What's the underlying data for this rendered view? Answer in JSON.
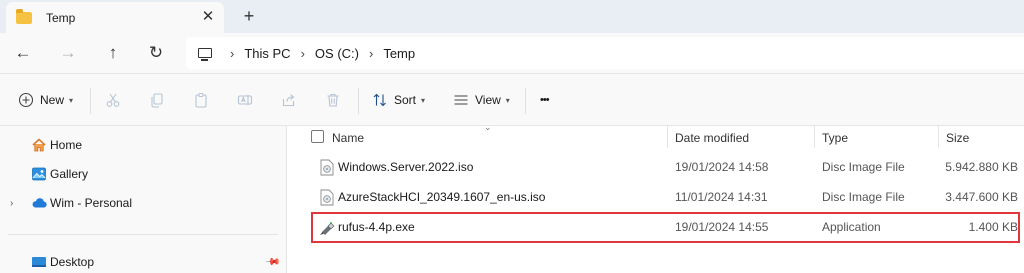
{
  "window": {
    "tab_title": "Temp",
    "tab_close": "✕",
    "new_tab": "+"
  },
  "nav": {
    "back": "←",
    "forward": "→",
    "up": "↑",
    "refresh": "↻",
    "breadcrumbs": [
      "This PC",
      "OS (C:)",
      "Temp"
    ],
    "separator": "›"
  },
  "toolbar": {
    "new_label": "New",
    "sort_label": "Sort",
    "view_label": "View",
    "more_label": "•••",
    "icons": [
      "cut-icon",
      "copy-icon",
      "paste-icon",
      "rename-icon",
      "share-icon",
      "delete-icon"
    ]
  },
  "sidebar": {
    "items": [
      {
        "label": "Home",
        "icon": "home-icon"
      },
      {
        "label": "Gallery",
        "icon": "gallery-icon"
      },
      {
        "label": "Wim - Personal",
        "icon": "onedrive-cloud-icon"
      },
      {
        "label": "Desktop",
        "icon": "desktop-icon"
      }
    ]
  },
  "columns": {
    "name": "Name",
    "date_modified": "Date modified",
    "type": "Type",
    "size": "Size"
  },
  "files": [
    {
      "name": "Windows.Server.2022.iso",
      "date": "19/01/2024 14:58",
      "type": "Disc Image File",
      "size": "5.942.880 KB",
      "icon": "disc-image-icon"
    },
    {
      "name": "AzureStackHCI_20349.1607_en-us.iso",
      "date": "11/01/2024 14:31",
      "type": "Disc Image File",
      "size": "3.447.600 KB",
      "icon": "disc-image-icon"
    },
    {
      "name": "rufus-4.4p.exe",
      "date": "19/01/2024 14:55",
      "type": "Application",
      "size": "1.400 KB",
      "icon": "rufus-usb-icon",
      "highlighted": true
    }
  ],
  "colors": {
    "highlight_border": "#e0373c",
    "folder": "#f5c242",
    "accent": "#0067c0"
  }
}
